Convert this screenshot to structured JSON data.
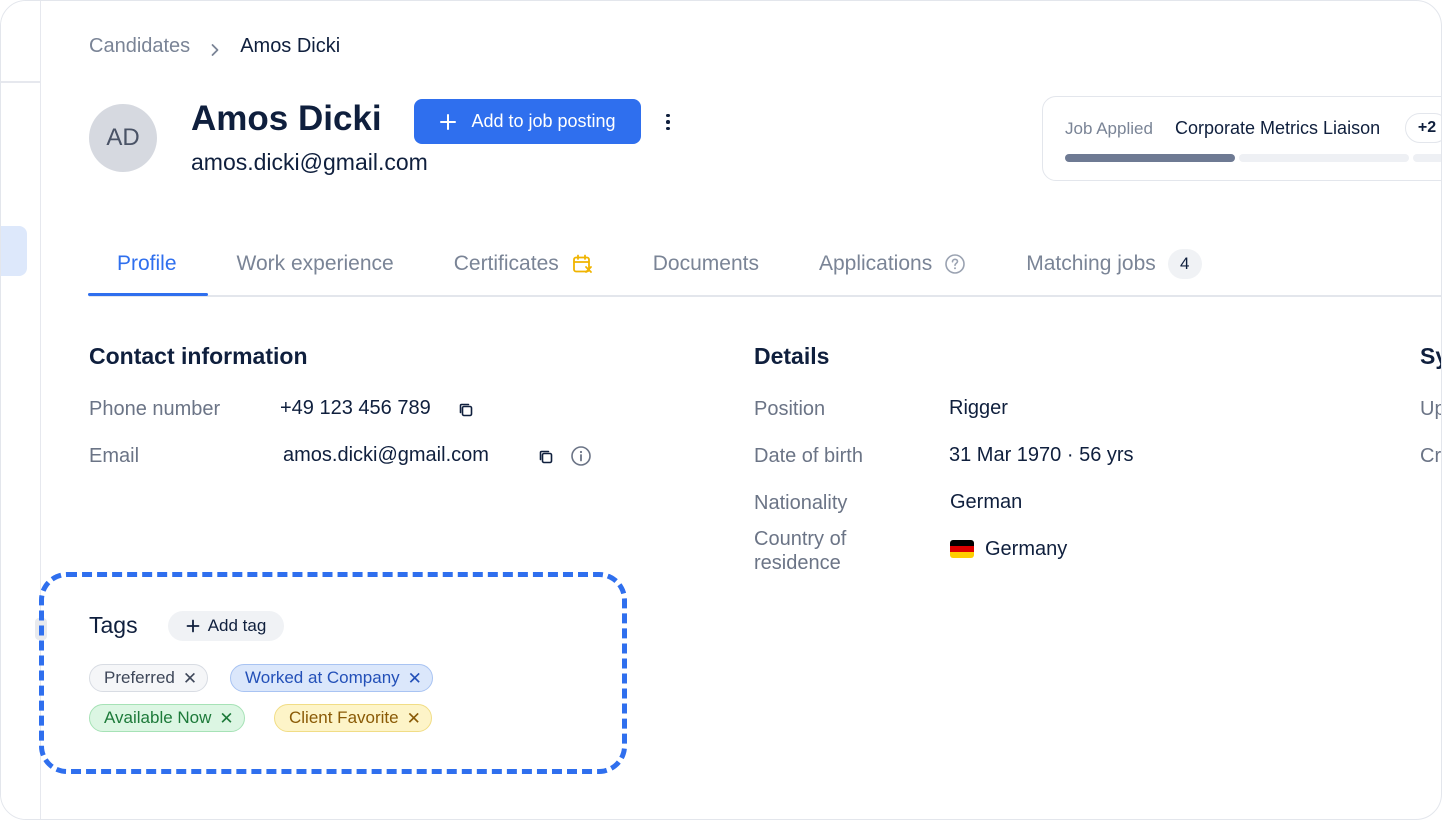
{
  "breadcrumb": {
    "parent": "Candidates",
    "current": "Amos Dicki"
  },
  "candidate": {
    "initials": "AD",
    "name": "Amos Dicki",
    "email": "amos.dicki@gmail.com"
  },
  "actions": {
    "add_to_job_label": "Add to job posting"
  },
  "job_applied": {
    "label": "Job Applied",
    "title": "Corporate Metrics Liaison",
    "more": "+2",
    "progress": 0.4
  },
  "tabs": [
    {
      "label": "Profile",
      "active": true
    },
    {
      "label": "Work experience"
    },
    {
      "label": "Certificates",
      "icon": "calendar-warning-icon"
    },
    {
      "label": "Documents"
    },
    {
      "label": "Applications",
      "icon": "help-circle-icon"
    },
    {
      "label": "Matching jobs",
      "badge": "4"
    }
  ],
  "contact": {
    "title": "Contact information",
    "phone_label": "Phone number",
    "phone_value": "+49 123 456 789",
    "email_label": "Email",
    "email_value": "amos.dicki@gmail.com"
  },
  "details": {
    "title": "Details",
    "position_label": "Position",
    "position_value": "Rigger",
    "dob_label": "Date of birth",
    "dob_value": "31 Mar 1970 · 56 yrs",
    "nationality_label": "Nationality",
    "nationality_value": "German",
    "residence_label": "Country of residence",
    "residence_value": "Germany"
  },
  "system": {
    "title_partial": "Sy",
    "row1_partial": "Up",
    "row2_partial": "Cr"
  },
  "tags": {
    "title": "Tags",
    "add_label": "Add tag",
    "items": [
      {
        "label": "Preferred",
        "color": "gray"
      },
      {
        "label": "Worked at Company",
        "color": "blue"
      },
      {
        "label": "Available Now",
        "color": "green"
      },
      {
        "label": "Client Favorite",
        "color": "yellow"
      }
    ]
  },
  "colors": {
    "accent": "#2f6fee",
    "text": "#0f1f3d",
    "muted": "#7a8496"
  }
}
